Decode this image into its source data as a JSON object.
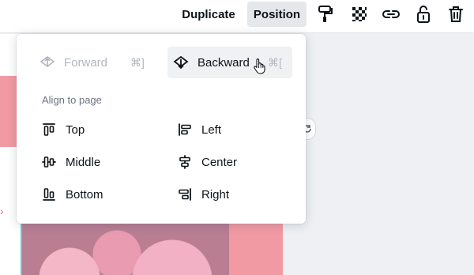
{
  "toolbar": {
    "duplicate_label": "Duplicate",
    "position_label": "Position",
    "icons": [
      "paint-roller-icon",
      "transparency-icon",
      "link-icon",
      "unlock-icon",
      "trash-icon"
    ]
  },
  "menu": {
    "forward": {
      "label": "Forward",
      "shortcut": "⌘]",
      "disabled": true
    },
    "backward": {
      "label": "Backward",
      "shortcut": "⌘[",
      "hovered": true
    },
    "section_label": "Align to page",
    "align": {
      "top": "Top",
      "left": "Left",
      "middle": "Middle",
      "center": "Center",
      "bottom": "Bottom",
      "right": "Right"
    }
  },
  "colors": {
    "accent_pink": "#f29aa3",
    "selection": "#4fd0d8",
    "disabled_text": "#b2b7bd"
  }
}
